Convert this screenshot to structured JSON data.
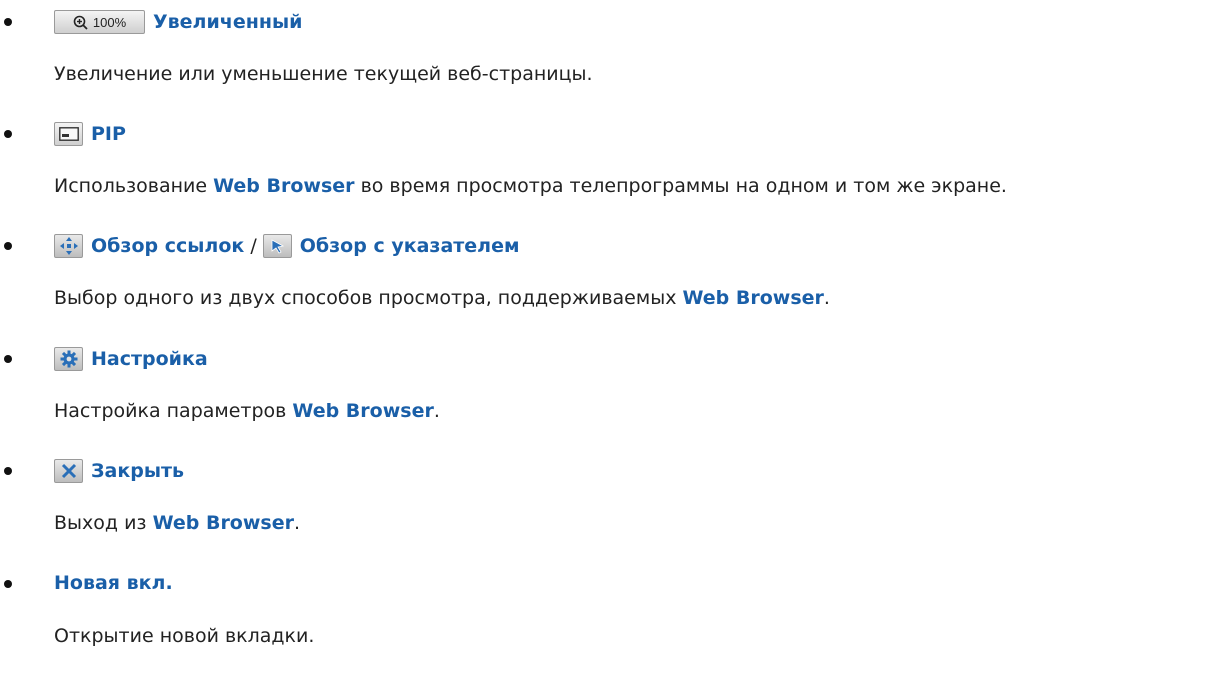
{
  "items": [
    {
      "icon_text": "100%",
      "term": "Увеличенный",
      "desc": "Увеличение или уменьшение текущей веб-страницы."
    },
    {
      "term": "PIP",
      "desc_before": "Использование ",
      "desc_hl": "Web Browser",
      "desc_after": " во время просмотра телепрограммы на одном и том же экране."
    },
    {
      "term1": "Обзор ссылок",
      "sep": "/",
      "term2": "Обзор с указателем",
      "desc_before": "Выбор одного из двух способов просмотра, поддерживаемых ",
      "desc_hl": "Web Browser",
      "desc_after": "."
    },
    {
      "term": "Настройка",
      "desc_before": "Настройка параметров ",
      "desc_hl": "Web Browser",
      "desc_after": "."
    },
    {
      "term": "Закрыть",
      "desc_before": "Выход из ",
      "desc_hl": "Web Browser",
      "desc_after": "."
    },
    {
      "term": "Новая вкл.",
      "desc": "Открытие новой вкладки."
    }
  ],
  "colors": {
    "term": "#1a5fa8",
    "text": "#222222",
    "icon_bg": "#d9d9d9"
  }
}
